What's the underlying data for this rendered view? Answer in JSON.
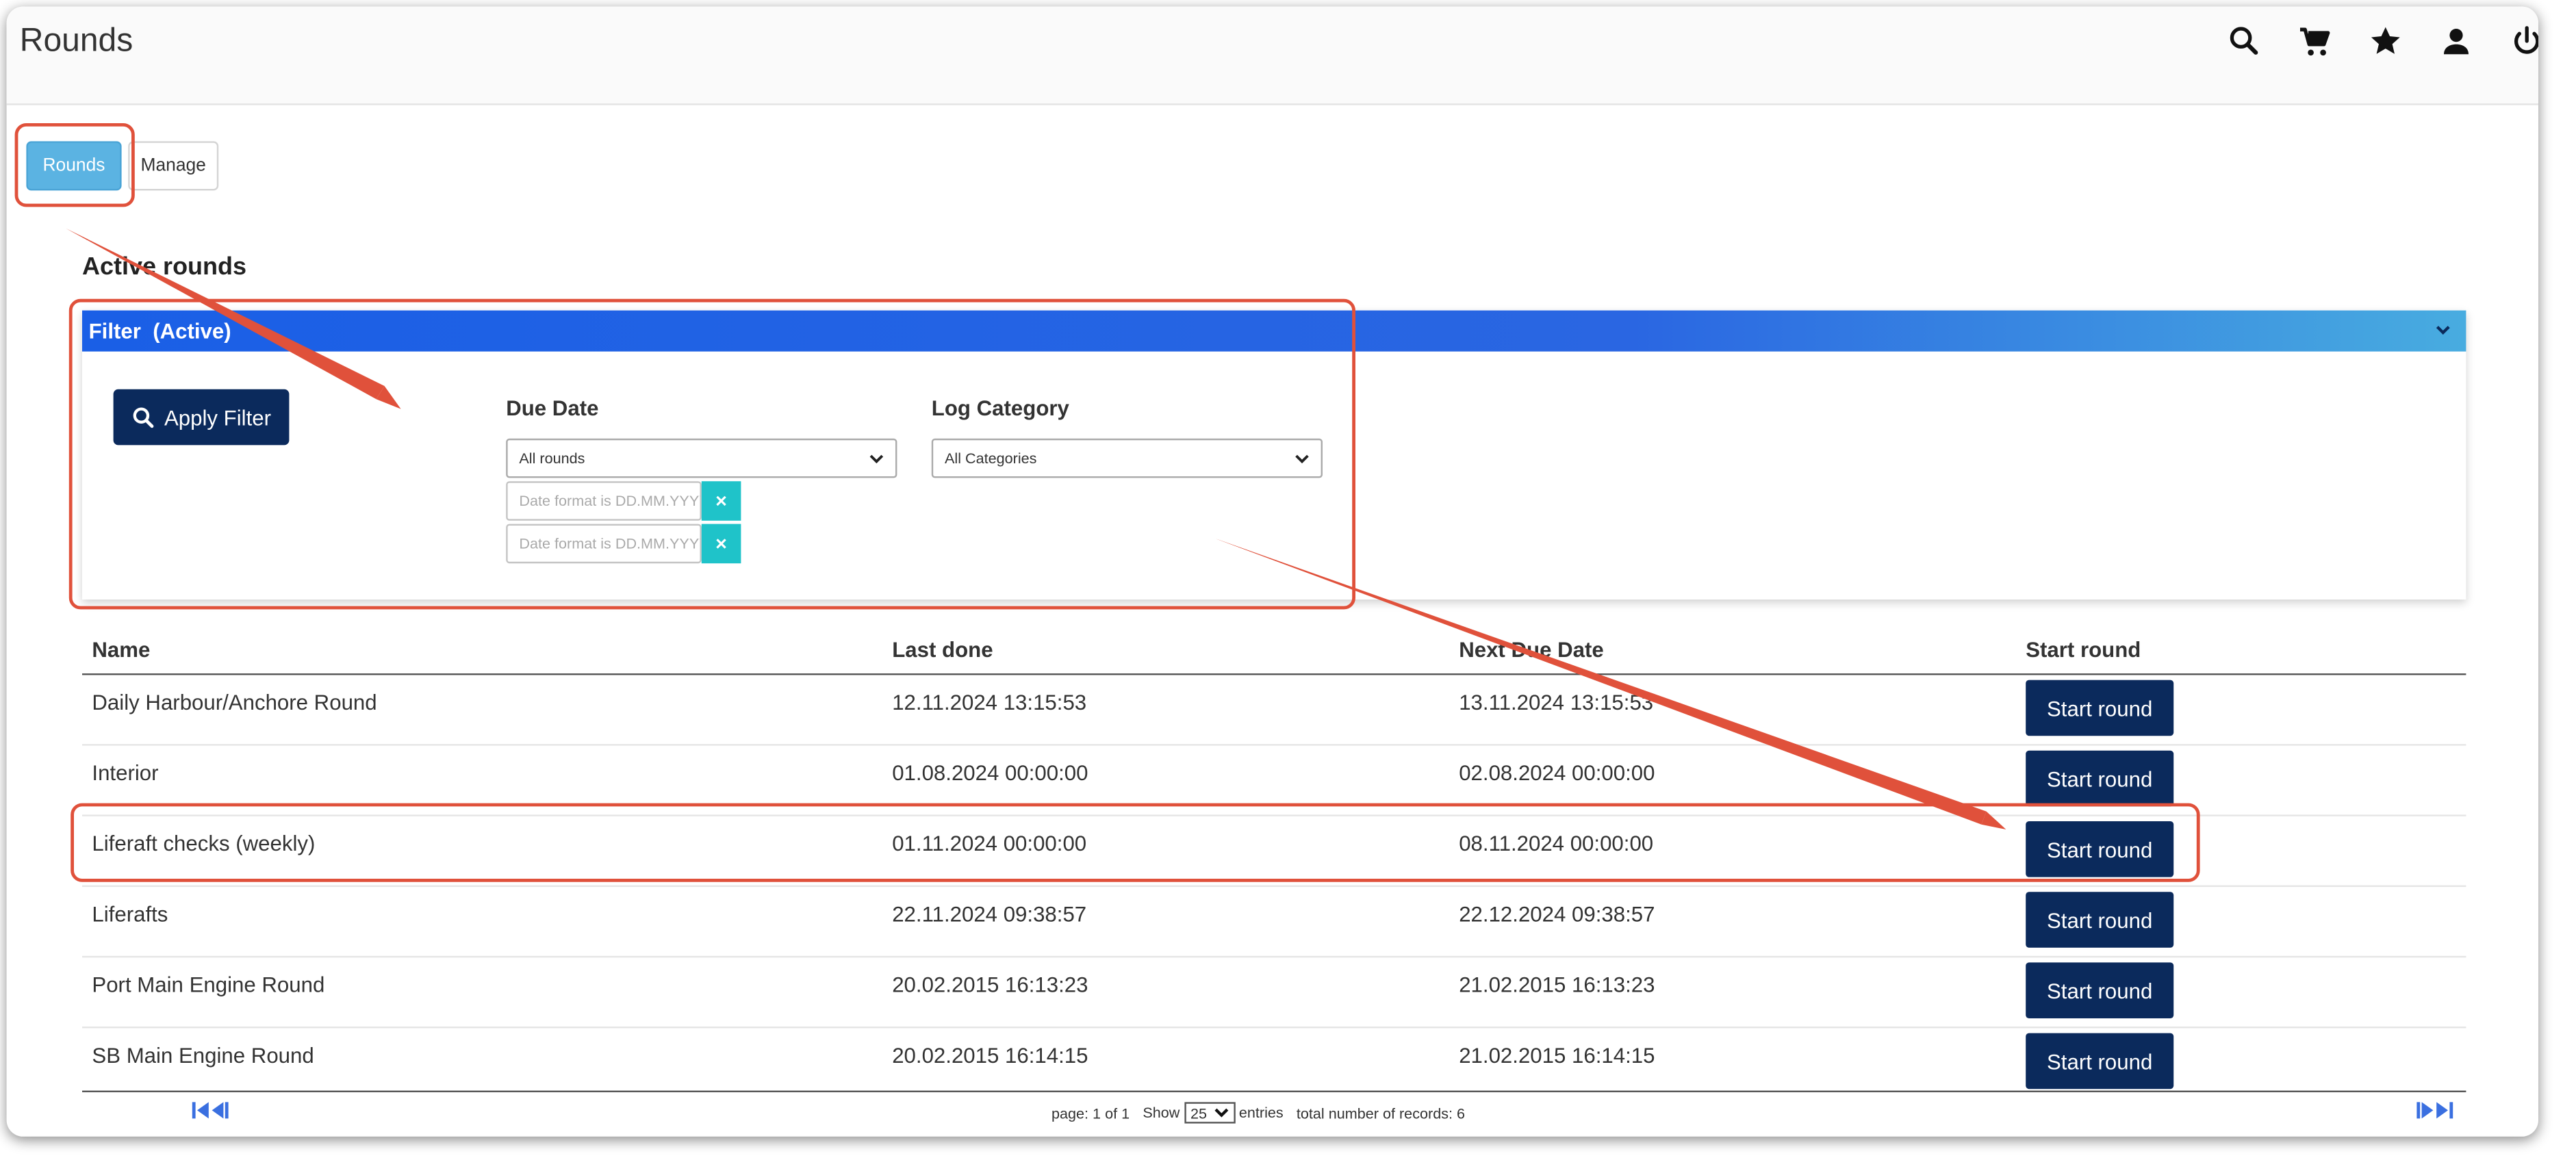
{
  "app": {
    "title": "Rounds"
  },
  "header_icons": [
    "search-icon",
    "cart-icon",
    "star-icon",
    "user-icon",
    "power-icon"
  ],
  "tabs": [
    {
      "label": "Rounds",
      "active": true
    },
    {
      "label": "Manage",
      "active": false
    }
  ],
  "section": {
    "title": "Active rounds"
  },
  "filter": {
    "title": "Filter  (Active)",
    "apply_label": "Apply Filter",
    "due_date": {
      "label": "Due Date",
      "selected": "All rounds",
      "from_placeholder": "Date format is DD.MM.YYYY",
      "to_placeholder": "Date format is DD.MM.YYYY",
      "clear_symbol": "×"
    },
    "log_category": {
      "label": "Log Category",
      "selected": "All Categories"
    }
  },
  "table": {
    "columns": [
      "Name",
      "Last done",
      "Next Due Date",
      "Start round"
    ],
    "start_label": "Start round",
    "rows": [
      {
        "name": "Daily Harbour/Anchore Round",
        "last_done": "12.11.2024 13:15:53",
        "next_due": "13.11.2024 13:15:53"
      },
      {
        "name": "Interior",
        "last_done": "01.08.2024 00:00:00",
        "next_due": "02.08.2024 00:00:00"
      },
      {
        "name": "Liferaft checks (weekly)",
        "last_done": "01.11.2024 00:00:00",
        "next_due": "08.11.2024 00:00:00"
      },
      {
        "name": "Liferafts",
        "last_done": "22.11.2024 09:38:57",
        "next_due": "22.12.2024 09:38:57"
      },
      {
        "name": "Port Main Engine Round",
        "last_done": "20.02.2015 16:13:23",
        "next_due": "21.02.2015 16:13:23"
      },
      {
        "name": "SB Main Engine Round",
        "last_done": "20.02.2015 16:14:15",
        "next_due": "21.02.2015 16:14:15"
      }
    ]
  },
  "pager": {
    "page_text": "page: 1 of 1",
    "show_label": "Show",
    "page_size": "25",
    "entries_label": "entries",
    "total_text": "total number of records: 6"
  },
  "colors": {
    "primary_button": "#0b2a5c",
    "active_tab": "#5bb3e2",
    "clear_button": "#1fc3c9",
    "annotation": "#e0513b"
  }
}
